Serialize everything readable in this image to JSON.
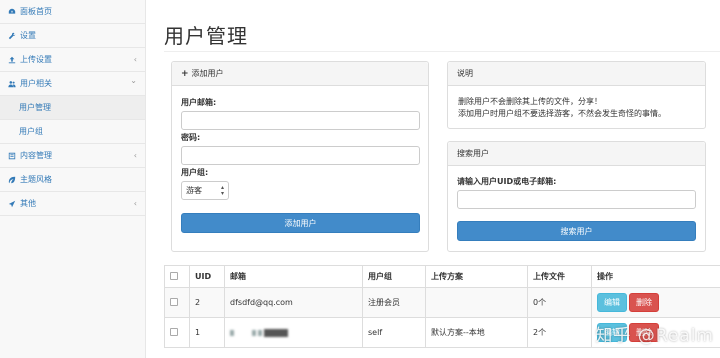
{
  "sidebar": {
    "items": [
      {
        "label": "面板首页",
        "icon": "dashboard-icon",
        "chevron": ""
      },
      {
        "label": "设置",
        "icon": "wrench-icon",
        "chevron": ""
      },
      {
        "label": "上传设置",
        "icon": "upload-icon",
        "chevron": "‹"
      },
      {
        "label": "用户相关",
        "icon": "users-icon",
        "chevron": "⌄"
      },
      {
        "label": "用户管理",
        "icon": "",
        "chevron": ""
      },
      {
        "label": "用户组",
        "icon": "",
        "chevron": ""
      },
      {
        "label": "内容管理",
        "icon": "list-icon",
        "chevron": "‹"
      },
      {
        "label": "主题风格",
        "icon": "leaf-icon",
        "chevron": ""
      },
      {
        "label": "其他",
        "icon": "send-icon",
        "chevron": "‹"
      }
    ]
  },
  "page": {
    "title": "用户管理"
  },
  "add_user": {
    "heading": "添加用户",
    "email_label": "用户邮箱:",
    "password_label": "密码:",
    "group_label": "用户组:",
    "group_selected": "游客",
    "submit_label": "添加用户"
  },
  "info": {
    "heading": "说明",
    "line1": "删除用户不会删除其上传的文件，分享！",
    "line2": "添加用户时用户组不要选择游客，不然会发生奇怪的事情。"
  },
  "search": {
    "heading": "搜索用户",
    "label": "请输入用户UID或电子邮箱:",
    "submit_label": "搜索用户"
  },
  "table": {
    "headers": [
      "UID",
      "邮箱",
      "用户组",
      "上传方案",
      "上传文件",
      "操作"
    ],
    "rows": [
      {
        "uid": "2",
        "email": "dfsdfd@qq.com",
        "group": "注册会员",
        "plan": "",
        "files": "0个",
        "edit": "编辑",
        "delete": "删除"
      },
      {
        "uid": "1",
        "email": "",
        "group": "self",
        "plan": "默认方案--本地",
        "files": "2个",
        "edit": "编辑",
        "delete": "删除"
      }
    ]
  },
  "watermark": "知乎 @Realm"
}
